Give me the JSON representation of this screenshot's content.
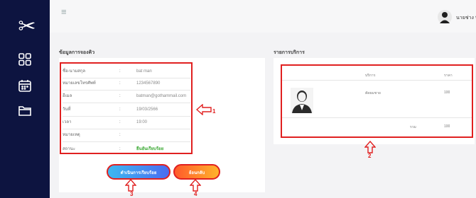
{
  "user": {
    "name": "นายช่าง ที"
  },
  "sections": {
    "booking_title": "ข้อมูลการจองคิว",
    "service_title": "รายการบริการ"
  },
  "booking": {
    "rows": [
      {
        "label": "ชื่อ-นามสกุล",
        "value": "bat man",
        "colon": ":"
      },
      {
        "label": "หมายเลขโทรศัพท์",
        "value": "1234567890",
        "colon": ":"
      },
      {
        "label": "อีเมล",
        "value": "batman@gothammail.com",
        "colon": ":"
      },
      {
        "label": "วันที่",
        "value": "19/03/2566",
        "colon": ":"
      },
      {
        "label": "เวลา",
        "value": "19:00",
        "colon": ":"
      },
      {
        "label": "หมายเหตุ",
        "value": "",
        "colon": ":"
      },
      {
        "label": "สถานะ",
        "value": "ยืนยันเรียบร้อย",
        "colon": ":"
      }
    ]
  },
  "service_table": {
    "headers": [
      "บริการ",
      "ราคา"
    ],
    "rows": [
      {
        "service": "ตัดผมชาย",
        "price": "100"
      }
    ],
    "total_label": "รวม",
    "total_value": "100"
  },
  "buttons": {
    "proceed": "ดำเนินการเรียบร้อย",
    "back": "ย้อนกลับ"
  },
  "markers": [
    "1",
    "2",
    "3",
    "4"
  ],
  "colors": {
    "sidebar": "#0d1440",
    "annotation": "#e02020",
    "status": "#3aa832"
  },
  "icons": [
    "scissors-icon",
    "dashboard-icon",
    "calendar-icon",
    "folder-icon",
    "hamburger-icon",
    "user-avatar-icon",
    "person-icon",
    "arrow-icon"
  ]
}
